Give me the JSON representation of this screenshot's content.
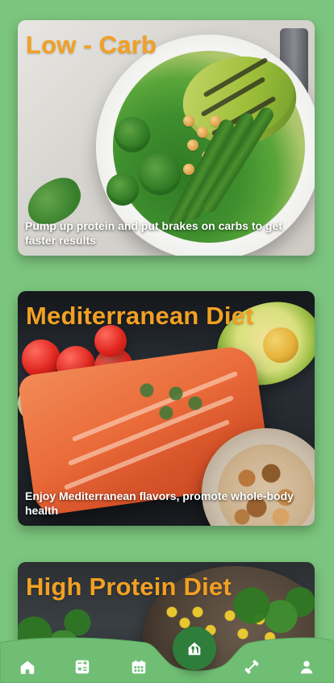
{
  "colors": {
    "background": "#7cc57e",
    "nav_bar": "#6fbe74",
    "nav_bar_stroke": "#5aa85f",
    "fab": "#2f7d3a",
    "title": "#f2a023",
    "description": "#ffffff",
    "icon": "#ffffff"
  },
  "cards": [
    {
      "title": "Low - Carb",
      "description": "Pump up protein and put  brakes on carbs to get faster results"
    },
    {
      "title": "Mediterranean Diet",
      "description": "Enjoy Mediterranean flavors, promote whole-body health"
    },
    {
      "title": "High Protein Diet",
      "description": ""
    }
  ],
  "nav": {
    "items": [
      {
        "icon": "home-icon"
      },
      {
        "icon": "calculator-icon"
      },
      {
        "icon": "calendar-icon"
      },
      {
        "icon": "meal-house-icon",
        "active": true
      },
      {
        "icon": "dumbbell-icon"
      },
      {
        "icon": "user-icon"
      }
    ]
  }
}
